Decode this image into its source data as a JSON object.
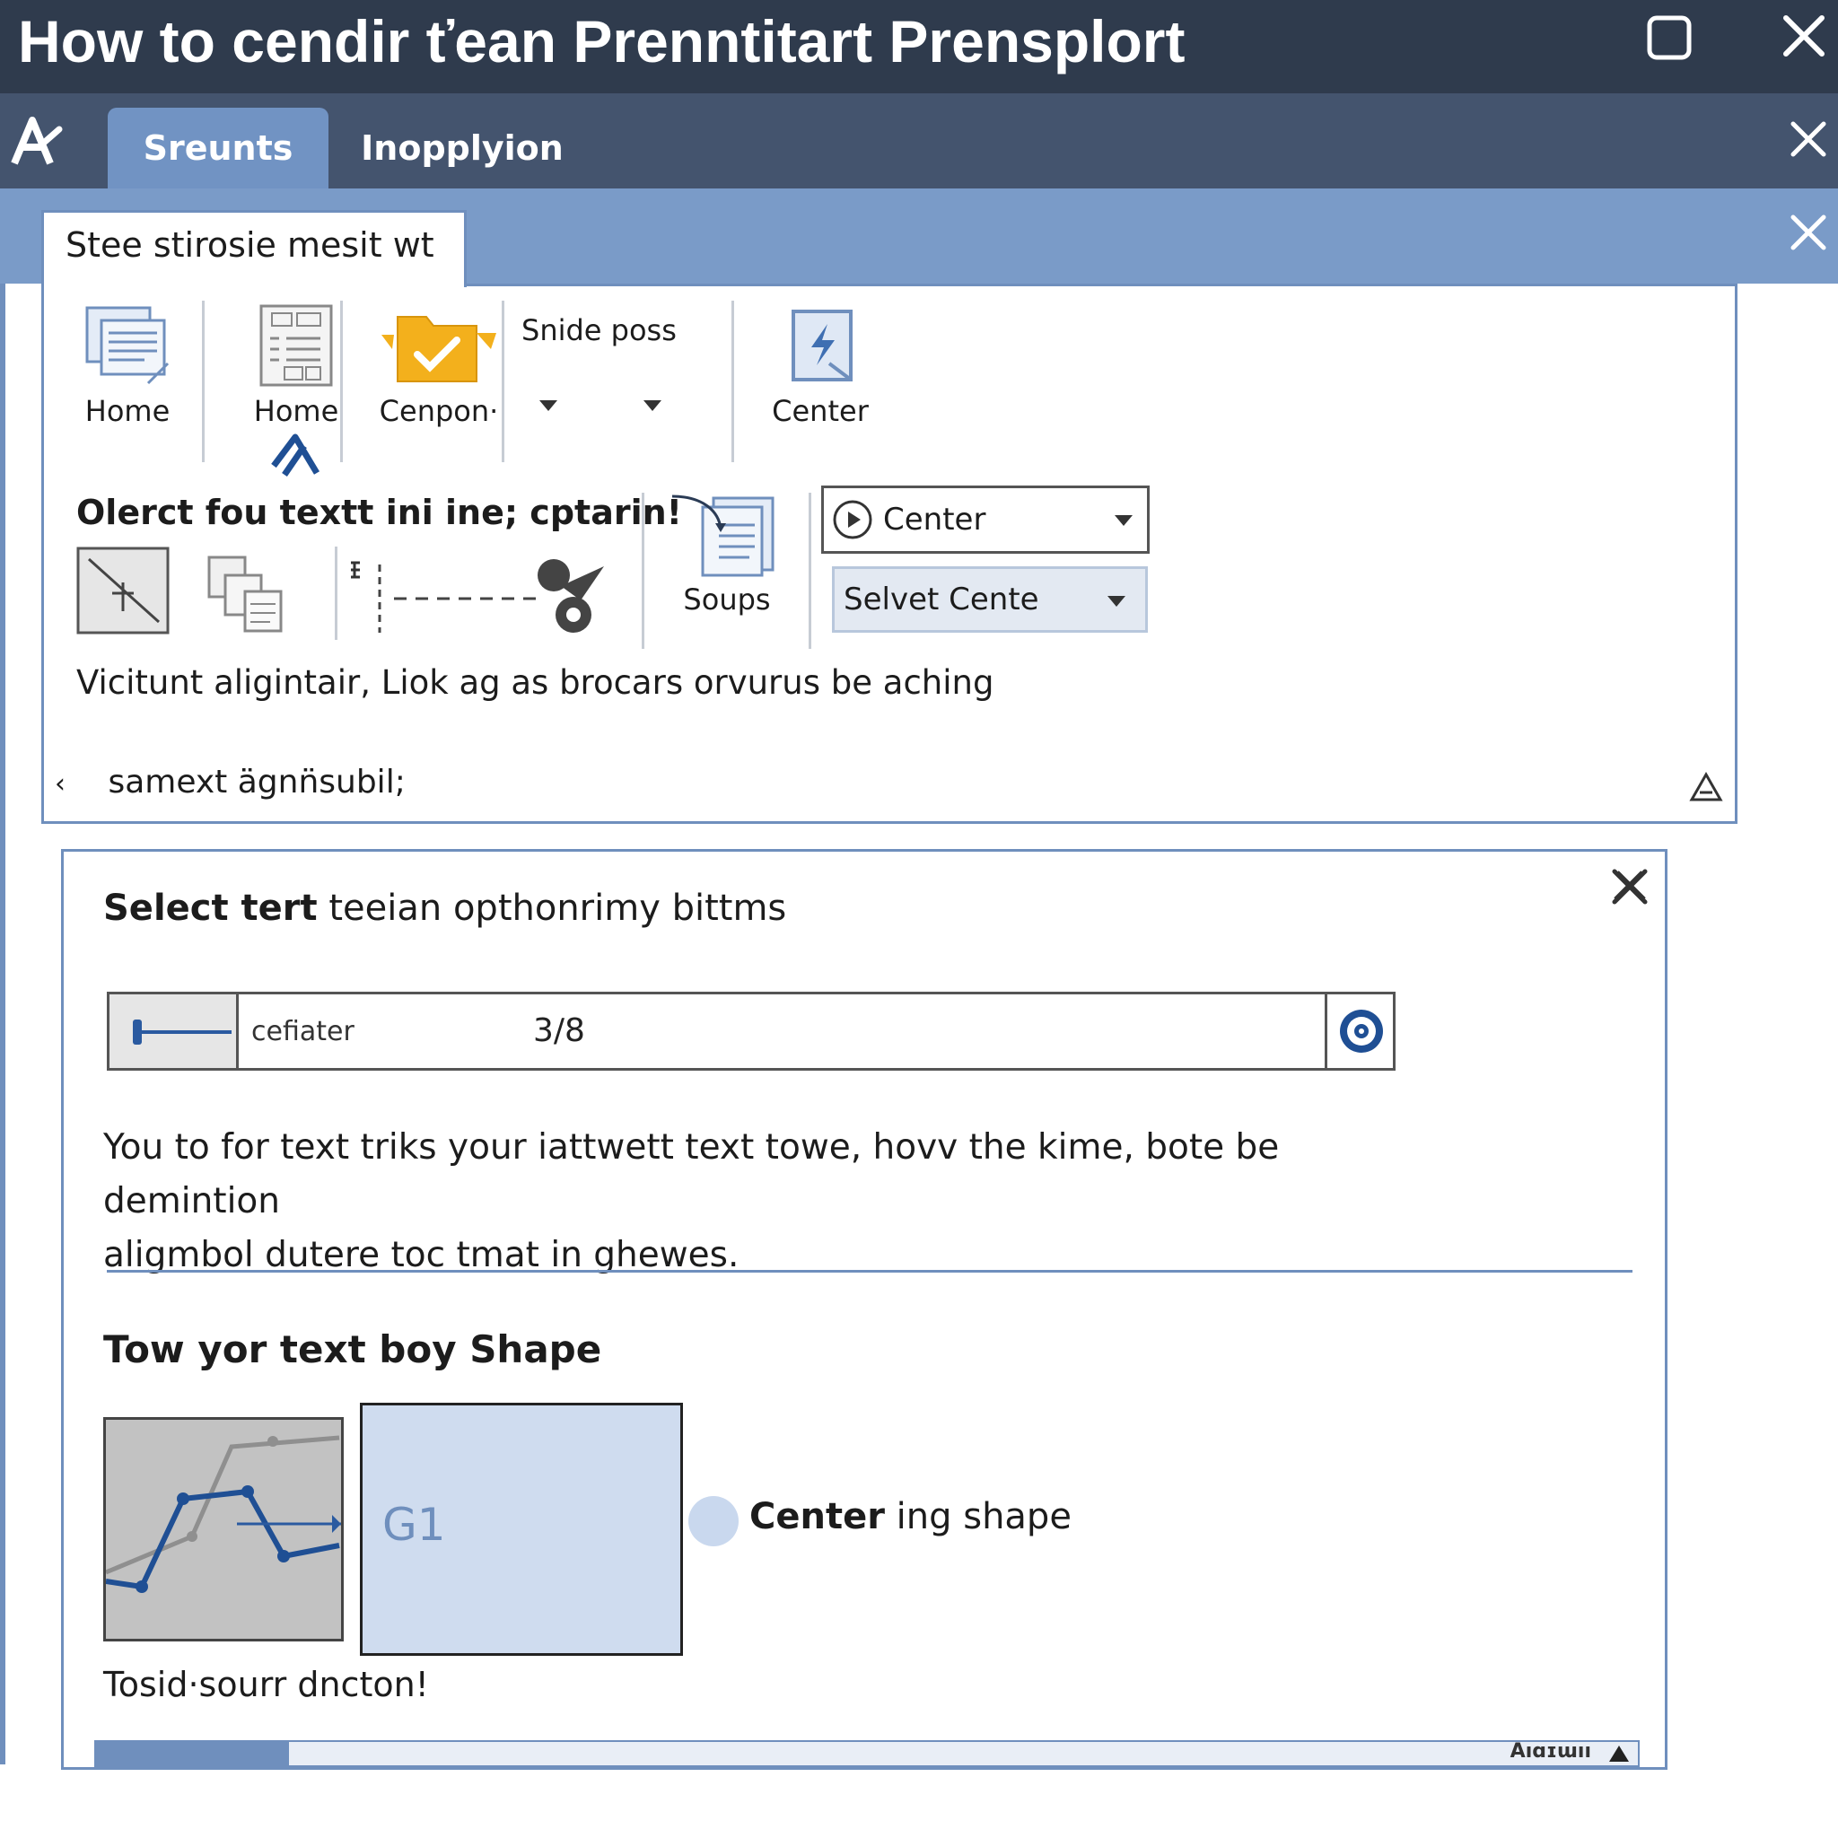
{
  "window": {
    "title": "How to cendir ťean Prenntitart Prensplort"
  },
  "tabs": [
    {
      "label": "Sreunts",
      "active": true
    },
    {
      "label": "Inopplyion",
      "active": false
    }
  ],
  "ribbon": {
    "tab_label": "Stee stirosie mesit wt",
    "tools": [
      {
        "label": "Home",
        "icon": "document-lines-icon"
      },
      {
        "label": "Home",
        "icon": "form-layout-icon"
      },
      {
        "label": "Cenpon·",
        "icon": "folder-check-icon"
      },
      {
        "label": "Snide poss",
        "icon": "dropdown-pair"
      },
      {
        "label": "Center",
        "icon": "lightning-page-icon"
      }
    ],
    "group2_heading": "Olerct fou textt ini ine; cptarin!",
    "soups_label": "Soups",
    "dropdown_center": "Center",
    "dropdown_select": "Selvet Cente",
    "description": "Vicitunt aligintair, Liok ag as brocars orvurus be aching",
    "footer_text": "samext ägnn̈subil;"
  },
  "dialog": {
    "heading_bold": "Select tert",
    "heading_rest": " teeian opthonrimy bittms",
    "input_label": "cefiater",
    "input_value": "3/8",
    "body_line1": "You to for text triks your iattwett text towe, hovv the kime, bote be demintion",
    "body_line2": "aligmbol dutere toc tmat in ghewes.",
    "sub_heading": "Tow yor text boy Shape",
    "shape_label": "G1",
    "caption_bold": "Center",
    "caption_rest": " ing shape",
    "note": "Tosid·sourr dncton!",
    "progress_label": "Aıɑɪɯıı",
    "progress_fraction": 0.125
  },
  "colors": {
    "titlebar": "#2f3b4d",
    "tabbar": "#44546e",
    "accent": "#7193c3",
    "border": "#6f8fbd"
  }
}
